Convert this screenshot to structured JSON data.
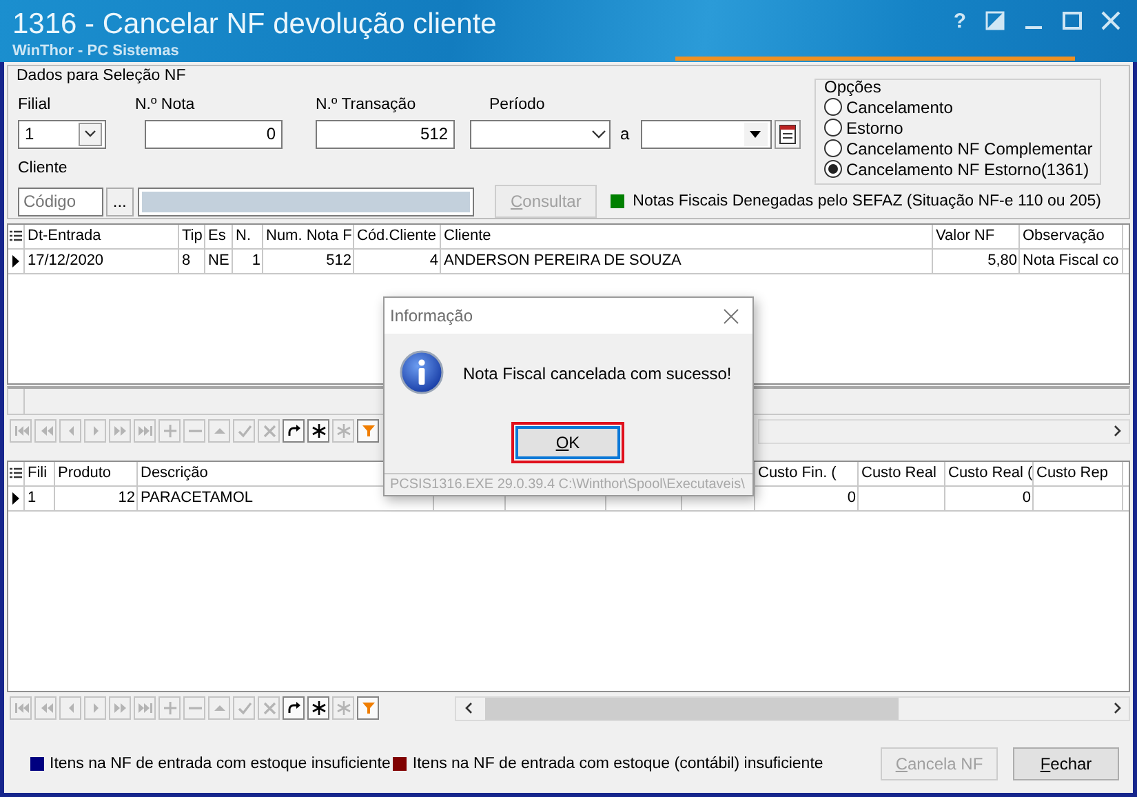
{
  "window": {
    "title": "1316 - Cancelar NF devolução cliente",
    "subtitle": "WinThor - PC Sistemas",
    "help_button": "?"
  },
  "selection": {
    "title": "Dados para Seleção NF",
    "filial": {
      "label": "Filial",
      "value": "1"
    },
    "nota": {
      "label": "N.º Nota",
      "value": "0"
    },
    "transacao": {
      "label": "N.º Transação",
      "value": "512"
    },
    "periodo": {
      "label": "Período",
      "separator": "a"
    },
    "cliente": {
      "label": "Cliente",
      "placeholder": "Código",
      "browse_button": "..."
    },
    "consultar_button": {
      "label": "Consultar",
      "mnemonic": true,
      "disabled": true
    },
    "sefaz_note": {
      "color": "#008000",
      "text": "Notas Fiscais Denegadas pelo SEFAZ (Situação NF-e 110 ou 205)"
    },
    "options": {
      "title": "Opções",
      "items": [
        {
          "label": "Cancelamento",
          "selected": false
        },
        {
          "label": "Estorno",
          "selected": false
        },
        {
          "label": "Cancelamento NF Complementar",
          "selected": false
        },
        {
          "label": "Cancelamento NF Estorno(1361)",
          "selected": true
        }
      ]
    }
  },
  "invoices_grid": {
    "columns": [
      "Dt-Entrada",
      "Tip",
      "Es",
      "N.",
      "Num. Nota F",
      "Cód.Cliente",
      "Cliente",
      "Valor NF",
      "Observação"
    ],
    "rows": [
      {
        "selected": true,
        "cells": [
          "17/12/2020",
          "8",
          "NE",
          "1",
          "512",
          "4",
          "ANDERSON PEREIRA DE SOUZA",
          "5,80",
          "Nota Fiscal co"
        ]
      }
    ],
    "toolbar": [
      {
        "kind": "first",
        "disabled": true
      },
      {
        "kind": "prev-page",
        "disabled": true
      },
      {
        "kind": "prev",
        "disabled": true
      },
      {
        "kind": "next",
        "disabled": true
      },
      {
        "kind": "next-page",
        "disabled": true
      },
      {
        "kind": "last",
        "disabled": true
      },
      {
        "kind": "add",
        "disabled": true
      },
      {
        "kind": "remove",
        "disabled": true
      },
      {
        "kind": "up",
        "disabled": true
      },
      {
        "kind": "confirm",
        "disabled": true
      },
      {
        "kind": "cancel",
        "disabled": true
      },
      {
        "kind": "refresh",
        "disabled": false
      },
      {
        "kind": "star",
        "disabled": false
      },
      {
        "kind": "star",
        "disabled": true
      },
      {
        "kind": "filter",
        "disabled": false
      }
    ]
  },
  "items_grid": {
    "columns": [
      "Fili",
      "Produto",
      "Descrição",
      null,
      null,
      null,
      null,
      "Custo Fin. (",
      "Custo Real",
      "Custo Real (",
      "Custo Rep"
    ],
    "rows": [
      {
        "selected": true,
        "cells": [
          "1",
          "12",
          "PARACETAMOL",
          null,
          null,
          null,
          null,
          "0",
          null,
          "0",
          null
        ]
      }
    ],
    "toolbar": [
      {
        "kind": "first",
        "disabled": true
      },
      {
        "kind": "prev-page",
        "disabled": true
      },
      {
        "kind": "prev",
        "disabled": true
      },
      {
        "kind": "next",
        "disabled": true
      },
      {
        "kind": "next-page",
        "disabled": true
      },
      {
        "kind": "last",
        "disabled": true
      },
      {
        "kind": "add",
        "disabled": true
      },
      {
        "kind": "remove",
        "disabled": true
      },
      {
        "kind": "up",
        "disabled": true
      },
      {
        "kind": "confirm",
        "disabled": true
      },
      {
        "kind": "cancel",
        "disabled": true
      },
      {
        "kind": "refresh",
        "disabled": false
      },
      {
        "kind": "star",
        "disabled": false
      },
      {
        "kind": "star",
        "disabled": true
      },
      {
        "kind": "filter",
        "disabled": false
      }
    ]
  },
  "legend": [
    {
      "color": "#000080",
      "text": "Itens na NF de entrada com estoque insuficiente"
    },
    {
      "color": "#800000",
      "text": "Itens na NF de entrada com estoque (contábil) insuficiente"
    }
  ],
  "buttons": [
    {
      "label": "Cancela NF",
      "mnemonic": true,
      "disabled": true
    },
    {
      "label": "Fechar",
      "mnemonic": true,
      "disabled": false
    }
  ],
  "dialog": {
    "title": "Informação",
    "message": "Nota Fiscal cancelada com sucesso!",
    "button": {
      "label": "OK",
      "mnemonic": true,
      "highlighted": true
    },
    "status": "PCSIS1316.EXE 29.0.39.4 C:\\Winthor\\Spool\\Executaveis\\"
  }
}
